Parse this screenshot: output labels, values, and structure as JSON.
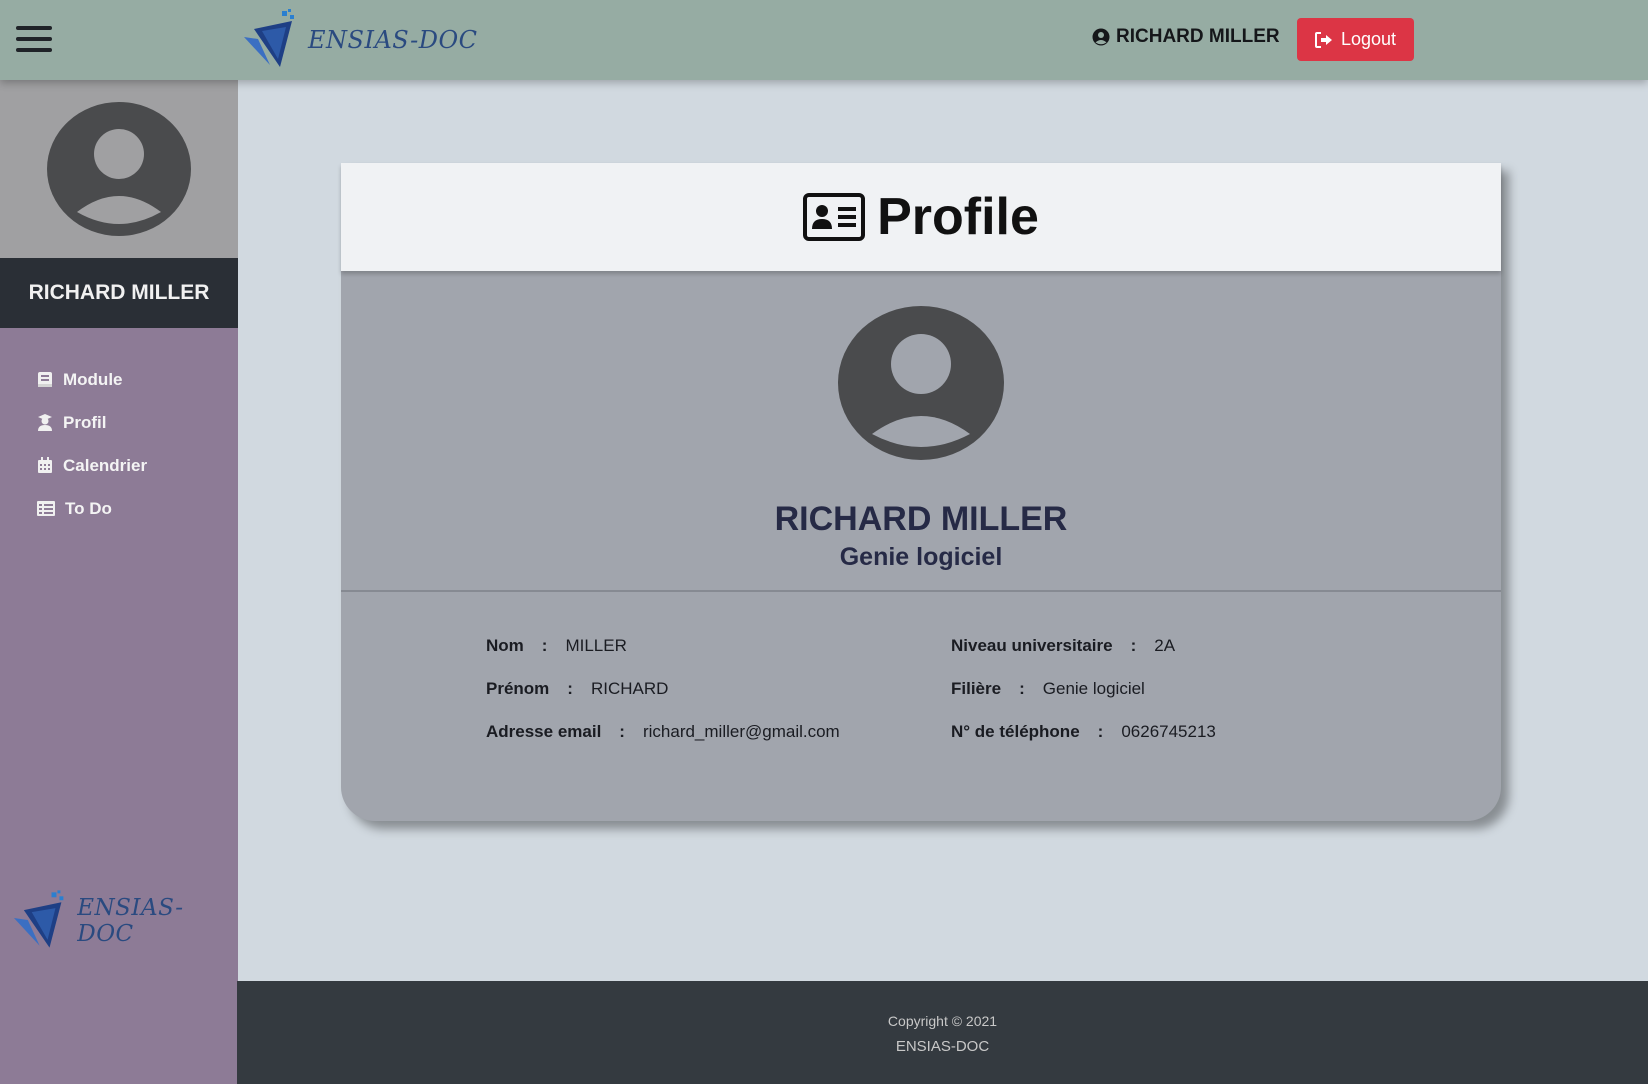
{
  "topbar": {
    "brand_text": "ENSIAS-DOC",
    "user_name": "RICHARD MILLER",
    "logout_label": "Logout"
  },
  "sidebar": {
    "user_name": "RICHARD MILLER",
    "items": [
      {
        "label": "Module",
        "icon": "book-icon"
      },
      {
        "label": "Profil",
        "icon": "user-graduate-icon"
      },
      {
        "label": "Calendrier",
        "icon": "calendar-icon"
      },
      {
        "label": "To Do",
        "icon": "list-icon"
      }
    ],
    "brand_text": "ENSIAS-DOC"
  },
  "profile": {
    "title": "Profile",
    "full_name": "RICHARD MILLER",
    "filiere_heading": "Genie logiciel",
    "fields": {
      "nom": {
        "label": "Nom",
        "value": "MILLER"
      },
      "prenom": {
        "label": "Prénom",
        "value": "RICHARD"
      },
      "email": {
        "label": "Adresse email",
        "value": "richard_miller@gmail.com"
      },
      "niveau": {
        "label": "Niveau universitaire",
        "value": "2A"
      },
      "filiere": {
        "label": "Filière",
        "value": "Genie logiciel"
      },
      "telephone": {
        "label": "N° de téléphone",
        "value": "0626745213"
      }
    },
    "separator": ":"
  },
  "footer": {
    "copyright": "Copyright © 2021",
    "brand": "ENSIAS-DOC"
  },
  "colors": {
    "topbar": "#96aca3",
    "sidebar": "#8d7b96",
    "logout": "#dc3545",
    "footer": "#343a40",
    "card": "#a1a5ad"
  }
}
